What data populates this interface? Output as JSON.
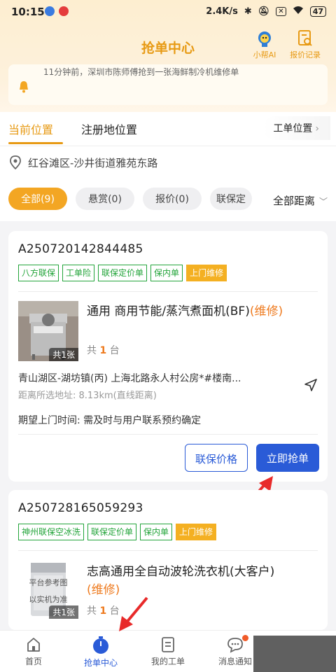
{
  "status_bar": {
    "time": "10:15",
    "net_speed": "2.4K/s",
    "battery": "47"
  },
  "header": {
    "title": "抢单中心",
    "ai_label": "小帮AI",
    "quote_record_label": "报价记录"
  },
  "notice": {
    "text": "11分钟前，深圳市陈师傅抢到一张海鲜制冷机维修单"
  },
  "location_tabs": {
    "current": "当前位置",
    "registered": "注册地位置",
    "order_location": "工单位置"
  },
  "address": "红谷滩区-沙井街道雅苑东路",
  "filters": {
    "chips": [
      "全部(9)",
      "悬赏(0)",
      "报价(0)",
      "联保定"
    ],
    "sort": "全部距离"
  },
  "orders": [
    {
      "order_no": "A250720142844485",
      "tags": [
        "八方联保",
        "工单险",
        "联保定价单",
        "保内单",
        "上门维修"
      ],
      "photo_count": "共1张",
      "product_name": "通用 商用节能/蒸汽煮面机(BF)",
      "repair_label": "(维修)",
      "qty_prefix": "共",
      "qty_value": "1",
      "qty_suffix": "台",
      "address": "青山湖区-湖坊镇(丙) 上海北路永人村公房*#楼南...",
      "distance": "距离所选地址: 8.13km(直线距离)",
      "expect_time": "期望上门时间: 需及时与用户联系预约确定",
      "btn_price": "联保价格",
      "btn_grab": "立即抢单"
    },
    {
      "order_no": "A250728165059293",
      "tags": [
        "神州联保空冰洗",
        "联保定价单",
        "保内单",
        "上门维修"
      ],
      "photo_text_1": "平台参考图",
      "photo_text_2": "以实机为准",
      "photo_count": "共1张",
      "product_name": "志高通用全自动波轮洗衣机(大客户)",
      "repair_label": "(维修)",
      "qty_prefix": "共",
      "qty_value": "1",
      "qty_suffix": "台"
    }
  ],
  "bottom_nav": {
    "items": [
      "首页",
      "抢单中心",
      "我的工单",
      "消息通知"
    ],
    "active": "抢单中心"
  },
  "colors": {
    "accent_orange": "#e79a14",
    "primary_blue": "#2a5bd7",
    "tag_green": "#23a43a",
    "repair_orange": "#ee7a1e"
  }
}
